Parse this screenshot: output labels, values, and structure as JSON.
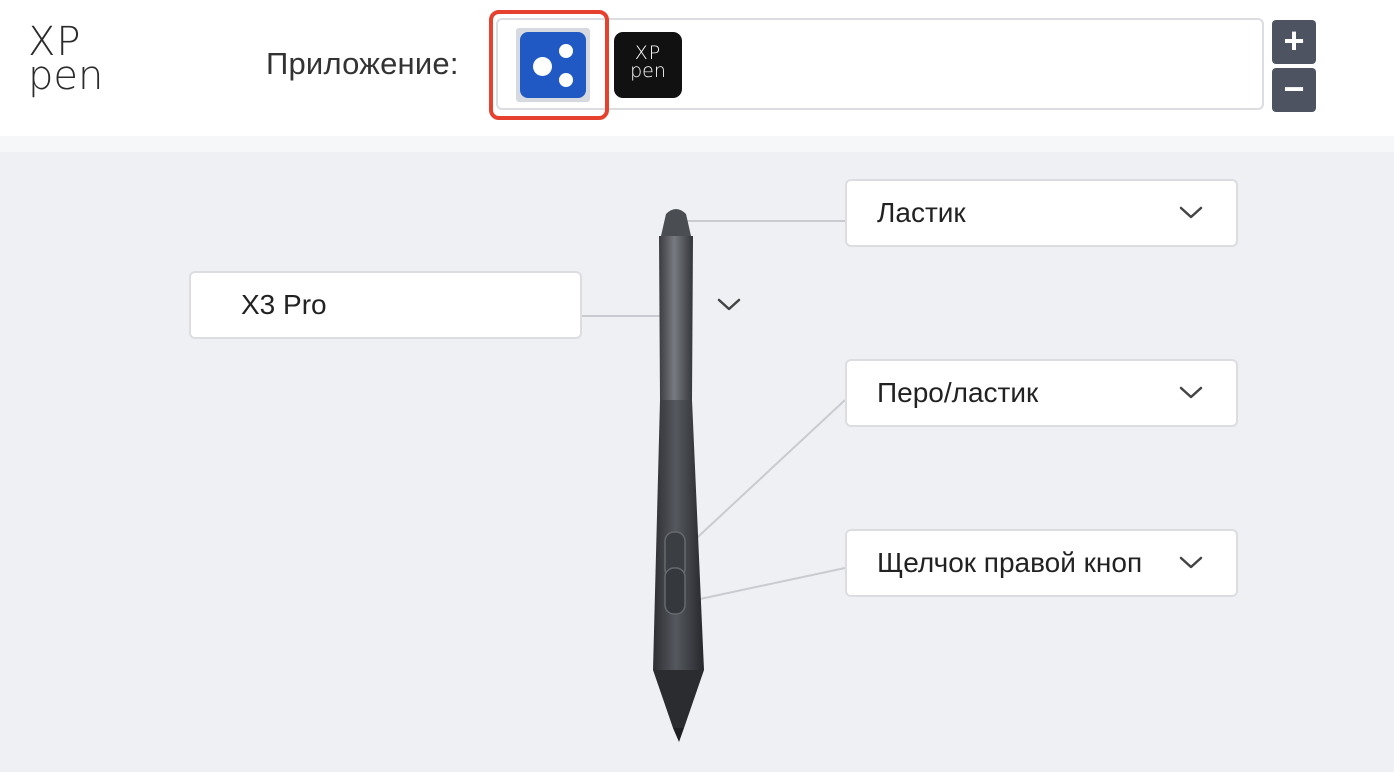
{
  "header": {
    "brand_logo": {
      "line1": "XP",
      "line2": "pen"
    },
    "app_label": "Приложение:",
    "apps": [
      {
        "name": "all-applications",
        "icon": "three-dots-icon",
        "selected": true,
        "color": "#2059c4"
      },
      {
        "name": "xp-pen-app",
        "icon": "xp-pen-logo",
        "line1": "XP",
        "line2": "pen"
      }
    ],
    "add_button": "+",
    "remove_button": "−",
    "highlight_color": "#e5412e"
  },
  "pen_settings": {
    "pen_model": {
      "value": "X3 Pro",
      "icon": "chevron-down-icon"
    },
    "top_button": {
      "value": "Ластик",
      "icon": "chevron-down-icon"
    },
    "upper_button": {
      "value": "Перо/ластик",
      "icon": "chevron-down-icon"
    },
    "lower_button": {
      "value": "Щелчок правой кноп",
      "icon": "chevron-down-icon"
    }
  }
}
